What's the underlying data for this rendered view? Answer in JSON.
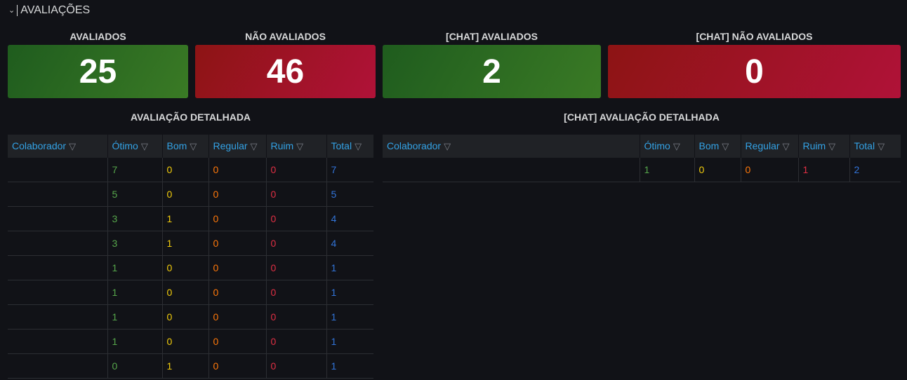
{
  "row": {
    "title": "AVALIAÇÕES"
  },
  "stats": [
    {
      "title": "AVALIADOS",
      "value": "25",
      "color": "#37872d"
    },
    {
      "title": "NÃO AVALIADOS",
      "value": "46",
      "color": "#c4162a"
    },
    {
      "title": "[CHAT] AVALIADOS",
      "value": "2",
      "color": "#37872d"
    },
    {
      "title": "[CHAT] NÃO AVALIADOS",
      "value": "0",
      "color": "#c4162a"
    }
  ],
  "tables": {
    "left": {
      "title": "AVALIAÇÃO DETALHADA",
      "columns": [
        "Colaborador",
        "Ótimo",
        "Bom",
        "Regular",
        "Ruim",
        "Total"
      ],
      "rows": [
        [
          "",
          "7",
          "0",
          "0",
          "0",
          "7"
        ],
        [
          "",
          "5",
          "0",
          "0",
          "0",
          "5"
        ],
        [
          "",
          "3",
          "1",
          "0",
          "0",
          "4"
        ],
        [
          "",
          "3",
          "1",
          "0",
          "0",
          "4"
        ],
        [
          "",
          "1",
          "0",
          "0",
          "0",
          "1"
        ],
        [
          "",
          "1",
          "0",
          "0",
          "0",
          "1"
        ],
        [
          "",
          "1",
          "0",
          "0",
          "0",
          "1"
        ],
        [
          "",
          "1",
          "0",
          "0",
          "0",
          "1"
        ],
        [
          "",
          "0",
          "1",
          "0",
          "0",
          "1"
        ]
      ]
    },
    "right": {
      "title": "[CHAT] AVALIAÇÃO DETALHADA",
      "columns": [
        "Colaborador",
        "Ótimo",
        "Bom",
        "Regular",
        "Ruim",
        "Total"
      ],
      "rows": [
        [
          "",
          "1",
          "0",
          "0",
          "1",
          "2"
        ]
      ]
    }
  },
  "icons": {
    "filter": "filter-icon",
    "collapse": "chevron-down-icon"
  },
  "colors": {
    "otimo": "#56a64b",
    "bom": "#f2cc0c",
    "regular": "#ff780a",
    "ruim": "#e02f44",
    "total": "#3274d9",
    "header_text": "#33a2e5"
  }
}
